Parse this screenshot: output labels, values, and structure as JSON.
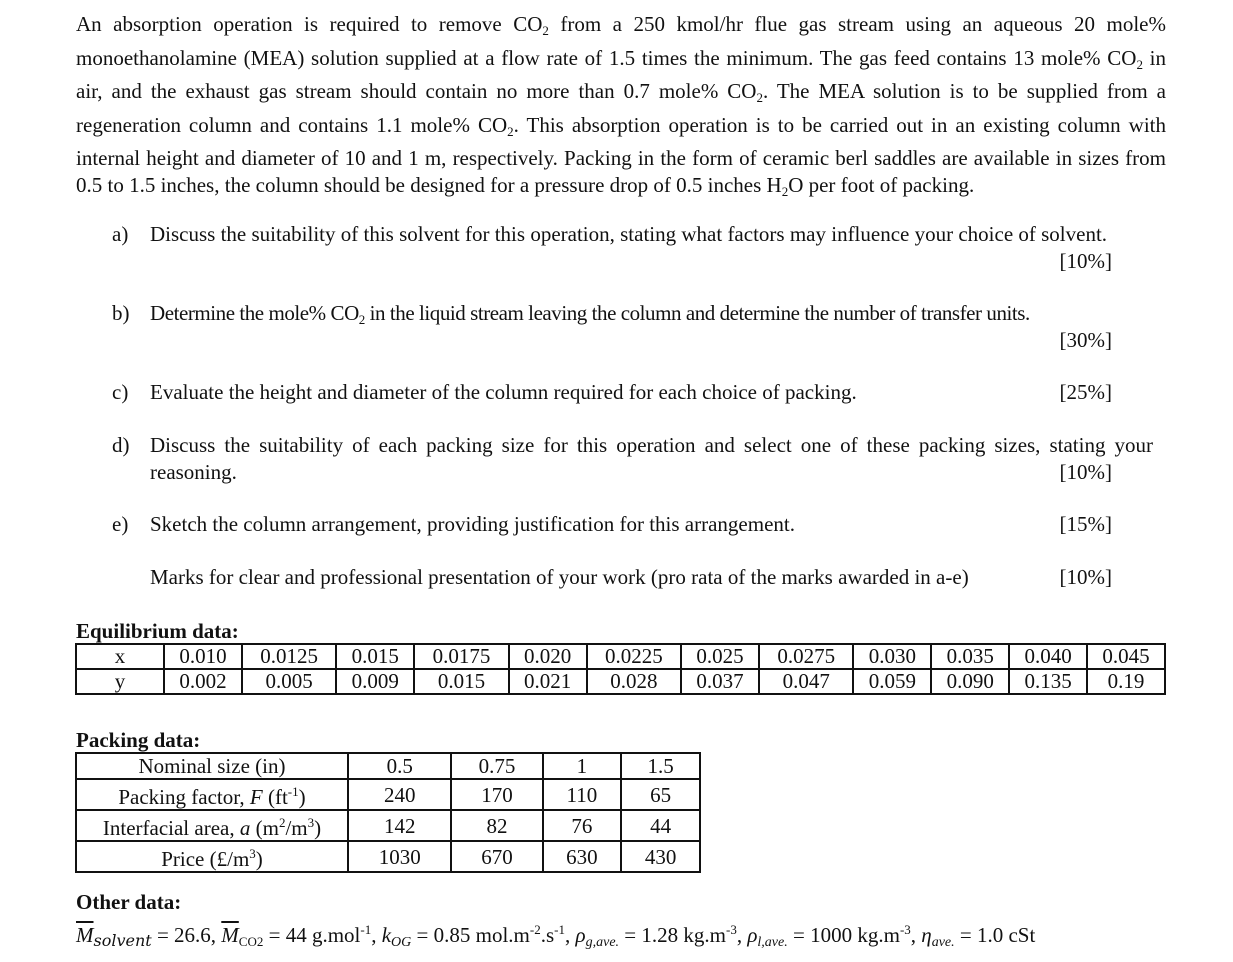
{
  "intro": {
    "p1": "An absorption operation is required to remove CO",
    "p1_sub": "2",
    "p2": " from a 250 kmol/hr flue gas stream using an aqueous 20 mole% monoethanolamine (MEA) solution supplied at a flow rate of 1.5 times the minimum. The gas feed contains 13 mole% CO",
    "p2_sub": "2",
    "p3": " in air, and the exhaust gas stream should contain no more than 0.7 mole% CO",
    "p3_sub": "2",
    "p4": ". The MEA solution is to be supplied from a regeneration column and contains 1.1 mole% CO",
    "p4_sub": "2",
    "p5": ". This absorption operation is to be carried out in an existing column with internal height and diameter of 10 and 1 m, respectively. Packing in the form of ceramic berl saddles are available in sizes from 0.5 to 1.5 inches, the column should be designed for a pressure drop of 0.5 inches H",
    "p5_sub": "2",
    "p6": "O per foot of packing."
  },
  "questions": [
    {
      "label": "a)",
      "text": "Discuss the suitability of this solvent for this operation, stating what factors may influence your choice of solvent.",
      "mark": "[10%]"
    },
    {
      "label": "b)",
      "text_pre": "Determine the mole% CO",
      "text_sub": "2",
      "text_post": " in the liquid stream leaving the column and determine the number of transfer units.",
      "mark": "[30%]"
    },
    {
      "label": "c)",
      "text": "Evaluate the height and diameter of the column required for each choice of packing.",
      "mark": "[25%]"
    },
    {
      "label": "d)",
      "text": "Discuss the suitability of each packing size for this operation and select one of these packing sizes, stating your reasoning.",
      "mark": "[10%]"
    },
    {
      "label": "e)",
      "text": "Sketch the column arrangement, providing justification for this arrangement.",
      "mark": "[15%]"
    },
    {
      "label": "",
      "text": "Marks for clear and professional presentation of your work (pro rata of the marks awarded in a-e)",
      "mark": "[10%]"
    }
  ],
  "equilibrium": {
    "title": "Equilibrium data:",
    "x_label": "x",
    "y_label": "y",
    "x": [
      "0.010",
      "0.0125",
      "0.015",
      "0.0175",
      "0.020",
      "0.0225",
      "0.025",
      "0.0275",
      "0.030",
      "0.035",
      "0.040",
      "0.045"
    ],
    "y": [
      "0.002",
      "0.005",
      "0.009",
      "0.015",
      "0.021",
      "0.028",
      "0.037",
      "0.047",
      "0.059",
      "0.090",
      "0.135",
      "0.19"
    ]
  },
  "packing": {
    "title": "Packing data:",
    "rows": [
      {
        "label": "Nominal size (in)",
        "values": [
          "0.5",
          "0.75",
          "1",
          "1.5"
        ]
      },
      {
        "label_pre": "Packing factor, ",
        "label_it": "F",
        "label_post": " (ft",
        "label_sup": "-1",
        "label_end": ")",
        "values": [
          "240",
          "170",
          "110",
          "65"
        ]
      },
      {
        "label_pre": "Interfacial area, ",
        "label_it": "a",
        "label_post": " (m",
        "label_sup": "2",
        "label_mid": "/m",
        "label_sup2": "3",
        "label_end": ")",
        "values": [
          "142",
          "82",
          "76",
          "44"
        ]
      },
      {
        "label_pre": "Price (£/m",
        "label_sup": "3",
        "label_end": ")",
        "values": [
          "1030",
          "670",
          "630",
          "430"
        ]
      }
    ]
  },
  "other": {
    "title": "Other data:",
    "m_solvent_sym": "M",
    "m_solvent_sub": "solvent",
    "m_solvent_val": " = 26.6, ",
    "m_co2_sym": "M",
    "m_co2_sub": "CO2",
    "m_co2_val": " = 44 g.mol",
    "m_co2_sup": "-1",
    "sep1": ", ",
    "kog_sym": "k",
    "kog_sub": "OG",
    "kog_val": " = 0.85 mol.m",
    "kog_sup1": "-2",
    "kog_mid": ".s",
    "kog_sup2": "-1",
    "sep2": ", ",
    "rho_g_sym": "ρ",
    "rho_g_sub": "g,ave.",
    "rho_g_val": " = 1.28 kg.m",
    "rho_g_sup": "-3",
    "sep3": ", ",
    "rho_l_sym": "ρ",
    "rho_l_sub": "l,ave.",
    "rho_l_val": " = 1000 kg.m",
    "rho_l_sup": "-3",
    "sep4": ", ",
    "eta_sym": "η",
    "eta_sub": "ave.",
    "eta_val": " = 1.0 cSt"
  }
}
